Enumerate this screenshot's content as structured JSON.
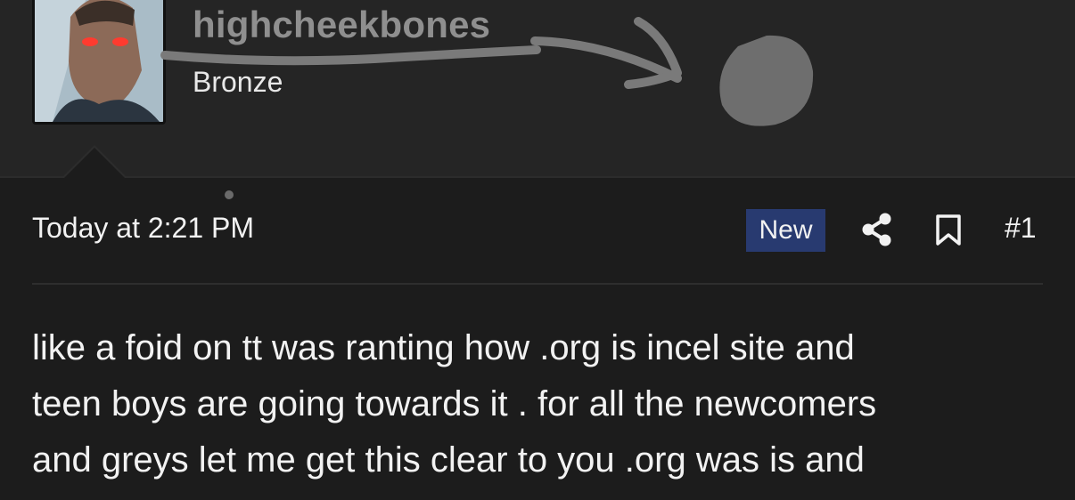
{
  "user": {
    "username": "highcheekbones",
    "rank": "Bronze"
  },
  "post": {
    "timestamp": "Today at 2:21 PM",
    "badge": "New",
    "number": "#1",
    "body_lines": [
      "like a foid on tt was ranting how .org is incel site and",
      "teen boys are going towards it . for all the newcomers",
      "and greys let me get this clear to you .org was is and"
    ]
  },
  "icons": {
    "share": "share-icon",
    "bookmark": "bookmark-icon",
    "avatar": "avatar-image"
  },
  "colors": {
    "background": "#1c1c1c",
    "header_background": "#252525",
    "badge_background": "#283a70",
    "username": "#8f8f8f",
    "text": "#f2f2f2"
  }
}
